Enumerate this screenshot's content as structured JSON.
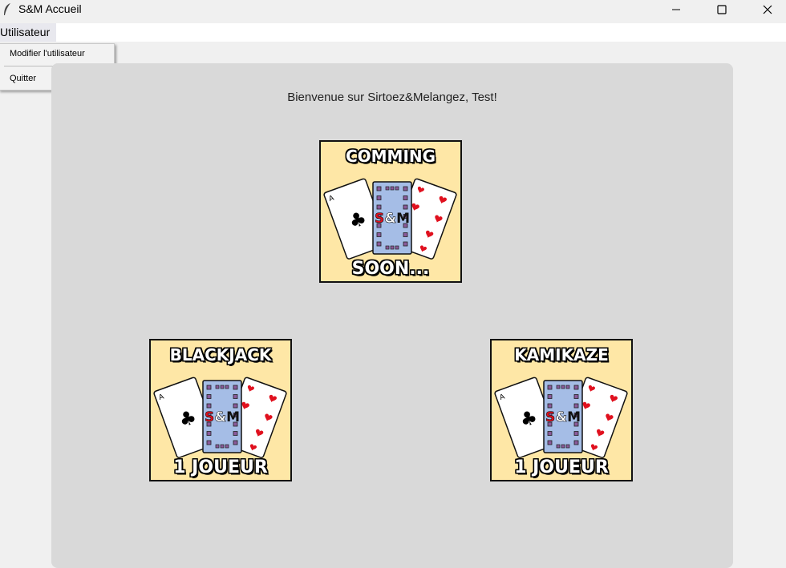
{
  "window": {
    "title": "S&M Accueil",
    "controls": {
      "minimize": "—",
      "maximize": "☐",
      "close": "✕"
    }
  },
  "menubar": {
    "utilisateur_label": "Utilisateur",
    "items": [
      {
        "label": "Modifier l'utilisateur"
      },
      {
        "label": "Quitter"
      }
    ]
  },
  "main": {
    "welcome_text": "Bienvenue sur Sirtoez&Melangez, Test!",
    "logo_text": "S&M",
    "cards": [
      {
        "top": "COMMING",
        "bottom": "SOON..."
      },
      {
        "top": "BLACKJACK",
        "bottom": "1 JOUEUR"
      },
      {
        "top": "KAMIKAZE",
        "bottom": "1 JOUEUR"
      }
    ]
  },
  "colors": {
    "card_bg": "#fee7a6",
    "card_back": "#a5bde6",
    "heart_red": "#e0101e",
    "panel_bg": "#d9d9d9"
  }
}
